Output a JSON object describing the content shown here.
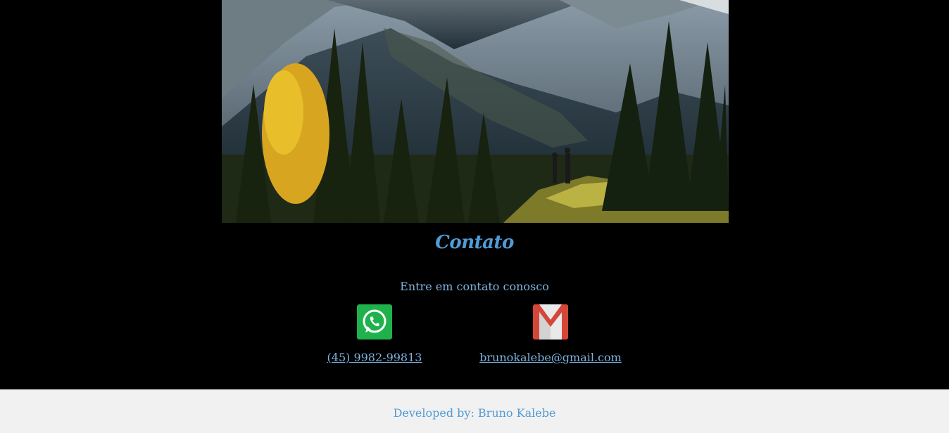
{
  "hero": {
    "image_alt": "mountain landscape with pine trees and two hikers"
  },
  "contact": {
    "title": "Contato",
    "subtitle": "Entre em contato conosco",
    "whatsapp": {
      "icon": "whatsapp-icon",
      "label": "(45) 9982-99813"
    },
    "email": {
      "icon": "gmail-icon",
      "label": "brunokalebe@gmail.com"
    }
  },
  "footer": {
    "text": "Developed by: Bruno Kalebe"
  },
  "colors": {
    "background": "#000000",
    "accent": "#4f9bd6",
    "link": "#7fb4e0",
    "footer_bg": "#f1f1f1",
    "whatsapp_green": "#1fb24c",
    "gmail_red": "#d44638"
  }
}
